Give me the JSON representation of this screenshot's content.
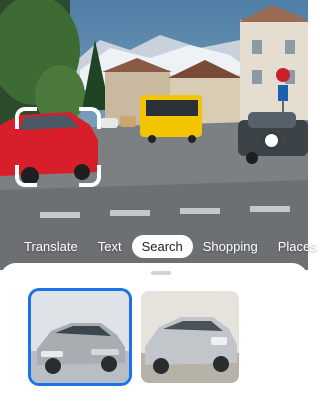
{
  "mode_tabs": {
    "items": [
      "Translate",
      "Text",
      "Search",
      "Shopping",
      "Places"
    ],
    "active_index": 2
  },
  "camera": {
    "scene_description_icons": [
      "crop-selection-icon",
      "target-dot-icon"
    ]
  },
  "results": {
    "cards": [
      {
        "name": "result-card-silver-sedan",
        "selected": true
      },
      {
        "name": "result-card-silver-hatchback",
        "selected": false
      }
    ]
  },
  "colors": {
    "accent_blue": "#1a73e8",
    "active_tab_bg": "#ffffff",
    "bus_yellow": "#f2c500",
    "car_red": "#d81e2a"
  }
}
